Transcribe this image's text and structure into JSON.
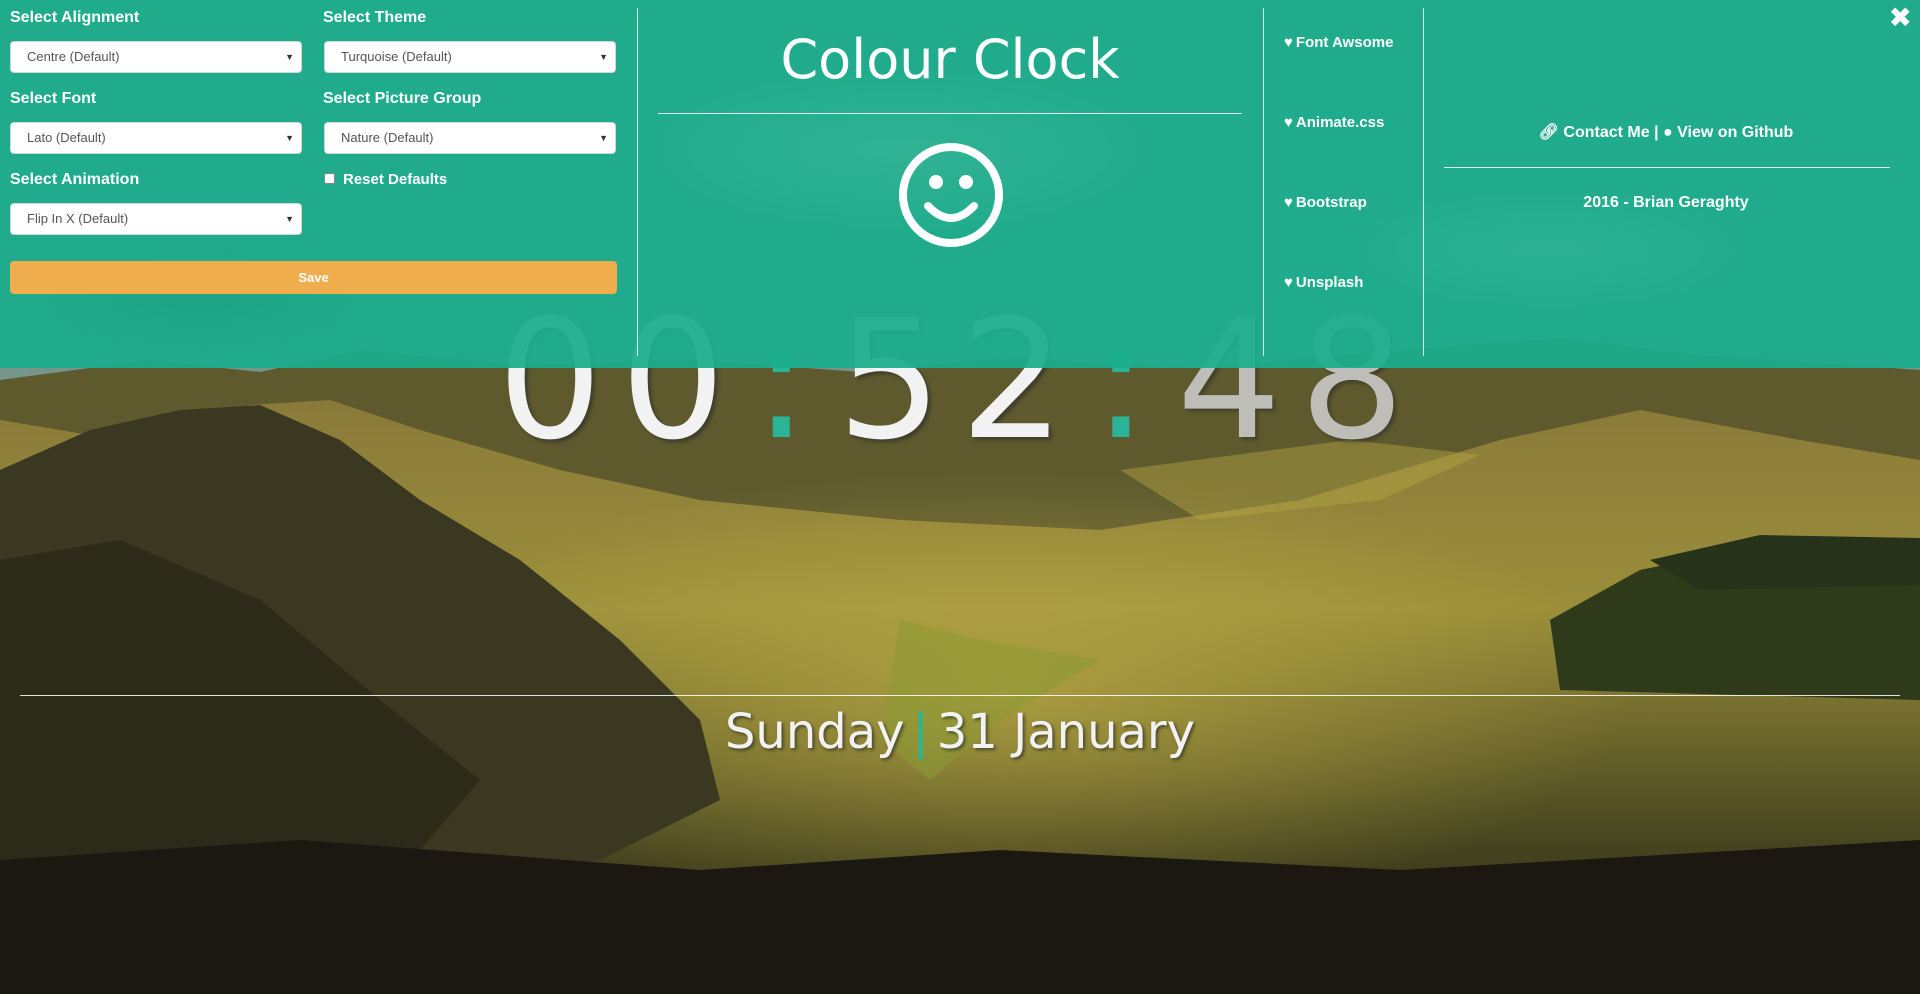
{
  "settings": {
    "alignment": {
      "label": "Select Alignment",
      "value": "Centre (Default)"
    },
    "theme": {
      "label": "Select Theme",
      "value": "Turquoise (Default)"
    },
    "font": {
      "label": "Select Font",
      "value": "Lato (Default)"
    },
    "picture_group": {
      "label": "Select Picture Group",
      "value": "Nature (Default)"
    },
    "animation": {
      "label": "Select Animation",
      "value": "Flip In X (Default)"
    },
    "reset_label": "Reset Defaults",
    "save_label": "Save"
  },
  "header": {
    "title": "Colour Clock",
    "smiley_icon": "smiley-face-icon"
  },
  "credits": [
    {
      "label": "Font Awsome",
      "icon": "heart-icon"
    },
    {
      "label": "Animate.css",
      "icon": "heart-icon"
    },
    {
      "label": "Bootstrap",
      "icon": "heart-icon"
    },
    {
      "label": "Unsplash",
      "icon": "heart-icon"
    }
  ],
  "links": {
    "contact": "Contact Me",
    "separator": "|",
    "github": "View on Github",
    "footer": "2016 - Brian Geraghty"
  },
  "clock": {
    "hours": "00",
    "minutes": "52",
    "seconds": "48",
    "separator": ":"
  },
  "date": {
    "day": "Sunday",
    "separator": "|",
    "date": "31 January"
  },
  "colors": {
    "accent": "#1aae8c",
    "button": "#f0ad4e"
  }
}
